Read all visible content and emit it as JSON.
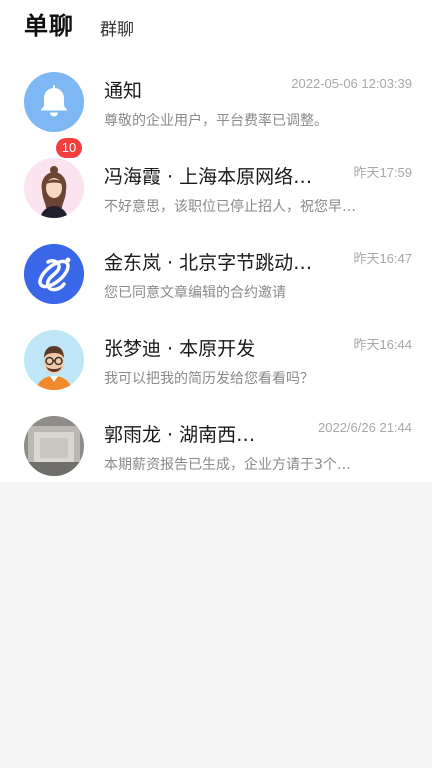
{
  "tabs": {
    "single": "单聊",
    "group": "群聊"
  },
  "conversations": [
    {
      "name": "通知",
      "time": "2022-05-06 12:03:39",
      "preview": "尊敬的企业用户，平台费率已调整。",
      "avatar_icon": "bell-icon",
      "avatar_color": "#7db8f4"
    },
    {
      "name": "冯海霞 · 上海本原网络…",
      "time": "昨天17:59",
      "preview": "不好意思，该职位已停止招人，祝您早…",
      "badge": "10",
      "avatar_icon": "woman-avatar",
      "badge_color": "#f43f3f"
    },
    {
      "name": "金东岚 · 北京字节跳动…",
      "time": "昨天16:47",
      "preview": "您已同意文章编辑的合约邀请",
      "avatar_icon": "company-logo",
      "avatar_color": "#3a67e8"
    },
    {
      "name": "张梦迪 · 本原开发",
      "time": "昨天16:44",
      "preview": "我可以把我的简历发给您看看吗？",
      "avatar_icon": "man-glasses-avatar",
      "avatar_color": "#bfe6f7"
    },
    {
      "name": "郭雨龙 · 湖南西…",
      "time": "2022/6/26 21:44",
      "preview": "本期薪资报告已生成，企业方请于3个…",
      "avatar_icon": "photo-avatar"
    }
  ]
}
